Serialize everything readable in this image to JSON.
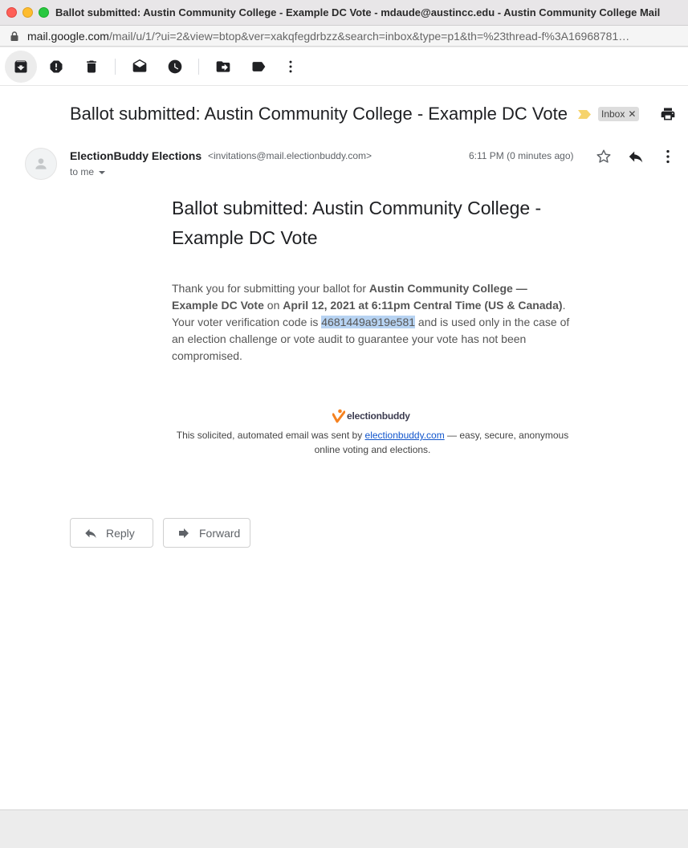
{
  "window": {
    "title": "Ballot submitted: Austin Community College - Example DC Vote - mdaude@austincc.edu - Austin Community College Mail"
  },
  "urlbar": {
    "host": "mail.google.com",
    "path": "/mail/u/1/?ui=2&view=btop&ver=xakqfegdrbzz&search=inbox&type=p1&th=%23thread-f%3A16968781…"
  },
  "toolbar": {
    "buttons": [
      {
        "name": "archive-button",
        "icon": "archive-icon"
      },
      {
        "name": "report-spam-button",
        "icon": "report-icon"
      },
      {
        "name": "delete-button",
        "icon": "trash-icon"
      },
      {
        "name": "mark-unread-button",
        "icon": "mail-open-icon"
      },
      {
        "name": "snooze-button",
        "icon": "clock-icon"
      },
      {
        "name": "move-to-button",
        "icon": "move-icon"
      },
      {
        "name": "labels-button",
        "icon": "label-icon"
      },
      {
        "name": "more-button",
        "icon": "more-vert-icon"
      }
    ]
  },
  "message": {
    "subject": "Ballot submitted: Austin Community College - Example DC Vote",
    "label": "Inbox",
    "sender_name": "ElectionBuddy Elections",
    "sender_email": "<invitations@mail.electionbuddy.com>",
    "to": "to me",
    "time": "6:11 PM (0 minutes ago)"
  },
  "body": {
    "title": "Ballot submitted: Austin Community College - Example DC Vote",
    "p_intro": "Thank you for submitting your ballot for ",
    "p_org": "Austin Community College — Example DC Vote",
    "p_on": " on ",
    "p_date": "April 12, 2021 at 6:11pm Central Time (US & Canada)",
    "p_dot": ".",
    "p_code_intro": " Your voter verification code is ",
    "p_code": "4681449a919e581",
    "p_rest": " and is used only in the case of an election challenge or vote audit to guarantee your vote has not been compromised."
  },
  "footer": {
    "logo_text": "electionbuddy",
    "text_before": "This solicited, automated email was sent by ",
    "link": "electionbuddy.com",
    "text_after": " — easy, secure, anonymous online voting and elections."
  },
  "actions": {
    "reply": "Reply",
    "forward": "Forward"
  },
  "colors": {
    "highlight": "#b7d3f2",
    "link": "#1155cc",
    "importance": "#f6d36b",
    "logo_orange": "#f58220"
  }
}
